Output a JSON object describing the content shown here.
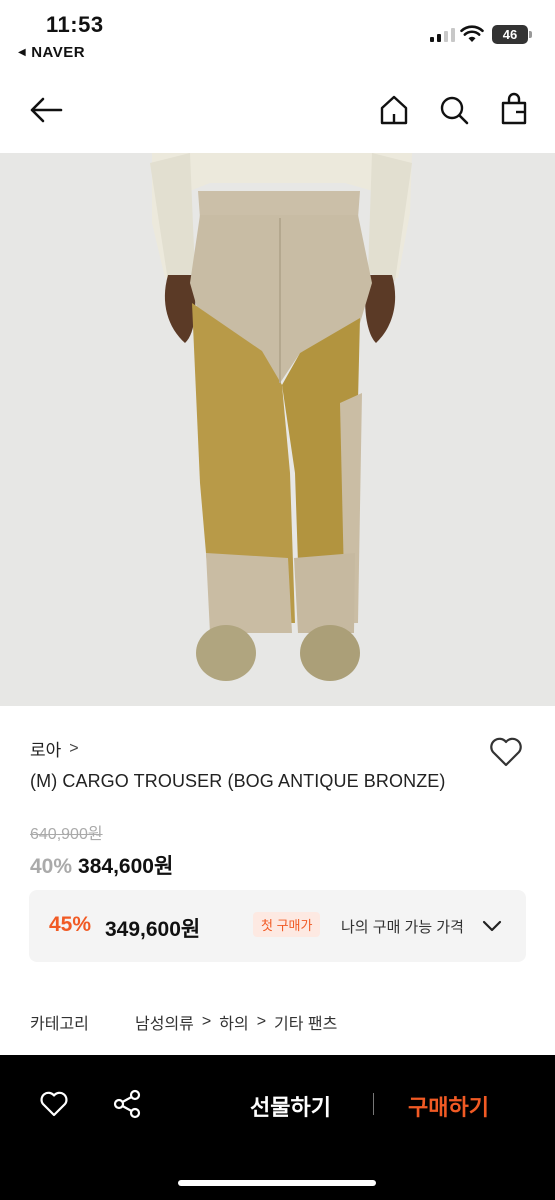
{
  "status_bar": {
    "time": "11:53",
    "back_app": "NAVER",
    "battery": "46"
  },
  "top_nav": {
    "icons": [
      "back-arrow-icon",
      "home-icon",
      "search-icon",
      "shopping-bag-icon"
    ]
  },
  "product": {
    "image_alt": "cargo trouser product photo",
    "brand": "로아",
    "brand_chevron": ">",
    "name": "(M) CARGO TROUSER (BOG ANTIQUE BRONZE)",
    "original_price": "640,900원",
    "discount_percent": "40%",
    "sale_price": "384,600원"
  },
  "my_price": {
    "discount_percent": "45%",
    "price": "349,600원",
    "badge": "첫 구매가",
    "label": "나의 구매 가능 가격"
  },
  "category": {
    "label": "카테고리",
    "path": [
      "남성의류",
      "하의",
      "기타 팬츠"
    ],
    "separator": ">"
  },
  "bottom_bar": {
    "gift_label": "선물하기",
    "buy_label": "구매하기"
  },
  "colors": {
    "accent": "#f15a24",
    "muted": "#aaaaaa",
    "bottom_bar_bg": "#000000"
  }
}
